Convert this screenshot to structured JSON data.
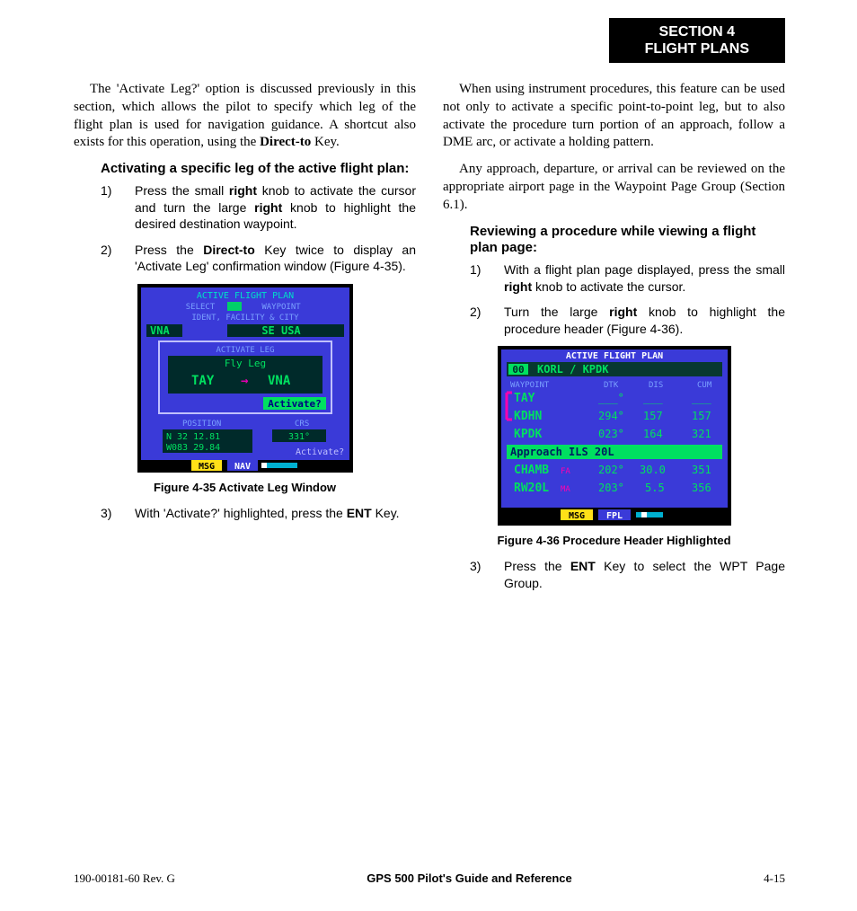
{
  "header": {
    "line1": "SECTION 4",
    "line2": "FLIGHT PLANS"
  },
  "left": {
    "intro": "The 'Activate Leg?' option is discussed previously in this section, which allows the pilot to specify which leg of the flight plan is used for navigation guidance.  A shortcut also exists for this operation, using the ",
    "intro_bold": "Direct-to",
    "intro_tail": " Key.",
    "sub1": "Activating a specific leg of the active flight plan:",
    "s1_1a": "Press the small ",
    "s1_1b": "right",
    "s1_1c": " knob to activate the cursor and turn the large ",
    "s1_1d": "right",
    "s1_1e": " knob to highlight the desired destination waypoint.",
    "s1_2a": "Press the ",
    "s1_2b": "Direct-to",
    "s1_2c": " Key twice to display an 'Activate Leg' confirmation window (Figure 4-35).",
    "fig35": {
      "title_top": "ACTIVE FLIGHT PLAN",
      "select": "SELECT",
      "waypoint": "WAYPOINT",
      "ident": "IDENT, FACILITY & CITY",
      "vna": "VNA",
      "seusa": "SE USA",
      "act_leg": "ACTIVATE LEG",
      "flyleg": "Fly Leg",
      "tay": "TAY",
      "vna2": "VNA",
      "activateq": "Activate?",
      "position": "POSITION",
      "crs": "CRS",
      "lat": "N 32 12.81",
      "lon": "W083 29.84",
      "crsv": "331°",
      "activate2": "Activate?",
      "msg": "MSG",
      "nav": "NAV",
      "caption": "Figure 4-35  Activate Leg Window"
    },
    "s1_3a": "With 'Activate?' highlighted, press the ",
    "s1_3b": "ENT",
    "s1_3c": " Key."
  },
  "right": {
    "p1": "When using instrument procedures, this feature can be used not only to activate a specific point-to-point leg, but to also activate the procedure turn portion of an approach, follow a DME arc, or activate a holding pattern.",
    "p2": "Any approach, departure, or arrival can be reviewed on the appropriate airport page in the Waypoint Page Group (Section 6.1).",
    "sub2": "Reviewing a procedure while viewing a flight plan page:",
    "s2_1a": "With a flight plan page displayed, press the small ",
    "s2_1b": "right",
    "s2_1c": " knob to activate the cursor.",
    "s2_2a": "Turn the large ",
    "s2_2b": "right",
    "s2_2c": " knob to highlight the procedure header (Figure 4-36).",
    "fig36": {
      "title": "ACTIVE FLIGHT PLAN",
      "plan_num": "00",
      "plan": "KORL / KPDK",
      "hdr_wpt": "WAYPOINT",
      "hdr_dtk": "DTK",
      "hdr_dis": "DIS",
      "hdr_cum": "CUM",
      "row1_wpt": "TAY",
      "row1_dtk": "___°",
      "row1_dis": "___",
      "row1_cum": "___",
      "row2_wpt": "KDHN",
      "row2_dtk": "294°",
      "row2_dis": "157",
      "row2_cum": "157",
      "row3_wpt": "KPDK",
      "row3_dtk": "023°",
      "row3_dis": "164",
      "row3_cum": "321",
      "approach": "Approach ILS 20L",
      "row4_wpt": "CHAMB",
      "row4_sfx": "FA",
      "row4_dtk": "202°",
      "row4_dis": "30.0",
      "row4_cum": "351",
      "row5_wpt": "RW20L",
      "row5_sfx": "MA",
      "row5_dtk": "203°",
      "row5_dis": "5.5",
      "row5_cum": "356",
      "msg": "MSG",
      "fpl": "FPL",
      "caption": "Figure 4-36  Procedure Header Highlighted"
    },
    "s2_3a": "Press the ",
    "s2_3b": "ENT",
    "s2_3c": " Key to select the WPT Page Group."
  },
  "footer": {
    "left": "190-00181-60  Rev. G",
    "mid": "GPS 500 Pilot's Guide and Reference",
    "right": "4-15"
  }
}
